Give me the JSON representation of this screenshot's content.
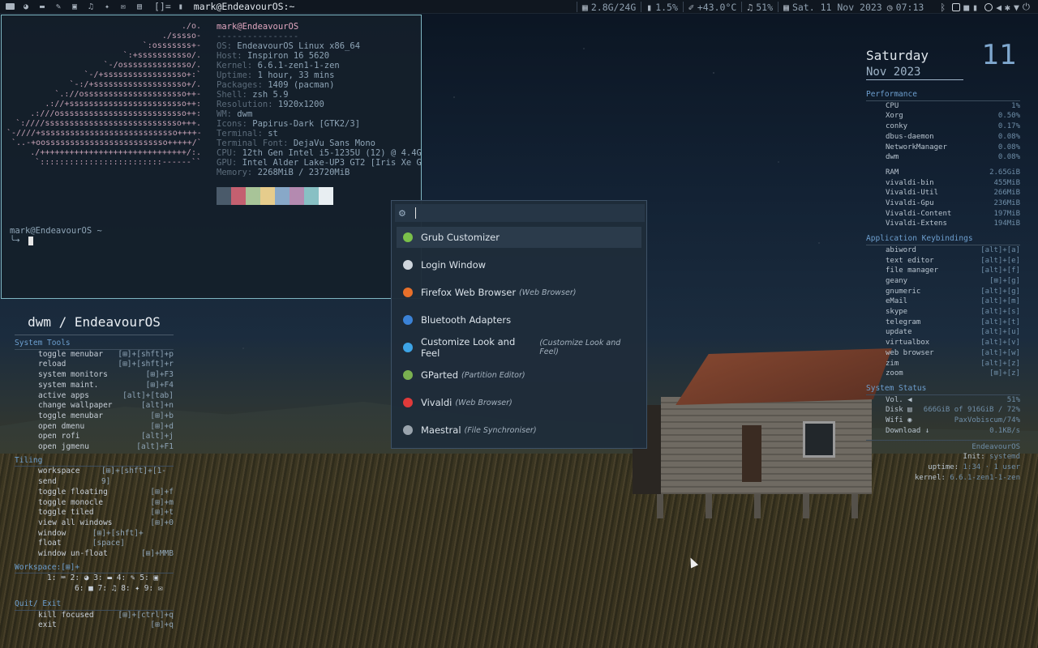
{
  "topbar": {
    "layout": "[]=",
    "window_title": "mark@EndeavourOS:~",
    "stats": {
      "memory": "2.8G/24G",
      "cpu": "1.5%",
      "temp": "+43.0°C",
      "volume": "51%",
      "datetime": "Sat. 11 Nov 2023",
      "time": "07:13"
    },
    "icons": [
      "terminal-icon",
      "globe-icon",
      "folder-icon",
      "editor-icon",
      "image-icon",
      "music-icon",
      "wrench-icon",
      "mail-icon",
      "archive-icon"
    ]
  },
  "terminal": {
    "art": "         ./o.\n       ./sssso-\n     `:osssssss+-\n   `:+sssssssssso/.\n `-/ossssssssssssso/.\n`-/+sssssssssssssssso+:`\n`-:/+sssssssssssssssssso+/.\n `.://osssssssssssssssssssso++-\n.://+ssssssssssssssssssssssso++:\n.:///ossssssssssssssssssssssssso++:\n`:////ssssssssssssssssssssssssssso+++.\n`-////+ssssssssssssssssssssssssssso++++-\n `..-+oosssssssssssssssssssssssso+++++/`\n   ./++++++++++++++++++++++++++++++/:.\n  `:::::::::::::::::::::::::------``",
    "host": "mark@EndeavourOS",
    "separator": "----------------",
    "lines": [
      {
        "k": "OS:",
        "v": "EndeavourOS Linux x86_64"
      },
      {
        "k": "Host:",
        "v": "Inspiron 16 5620"
      },
      {
        "k": "Kernel:",
        "v": "6.6.1-zen1-1-zen"
      },
      {
        "k": "Uptime:",
        "v": "1 hour, 33 mins"
      },
      {
        "k": "Packages:",
        "v": "1409 (pacman)"
      },
      {
        "k": "Shell:",
        "v": "zsh 5.9"
      },
      {
        "k": "Resolution:",
        "v": "1920x1200"
      },
      {
        "k": "WM:",
        "v": "dwm"
      },
      {
        "k": "Icons:",
        "v": "Papirus-Dark [GTK2/3]"
      },
      {
        "k": "Terminal:",
        "v": "st"
      },
      {
        "k": "Terminal Font:",
        "v": "DejaVu Sans Mono"
      },
      {
        "k": "CPU:",
        "v": "12th Gen Intel i5-1235U (12) @ 4.4G"
      },
      {
        "k": "GPU:",
        "v": "Intel Alder Lake-UP3 GT2 [Iris Xe G"
      },
      {
        "k": "Memory:",
        "v": "2268MiB / 23720MiB"
      }
    ],
    "palette": [
      "#4a5a6a",
      "#c46070",
      "#a8c498",
      "#e6cc8c",
      "#88a8c8",
      "#b48ab0",
      "#88c0c4",
      "#e8eef2"
    ],
    "prompt": "mark@EndeavourOS ~"
  },
  "cheat": {
    "title": "dwm / EndeavourOS",
    "sections": [
      {
        "name": "System Tools",
        "rows": [
          [
            "toggle menubar",
            "[⊞]+[shft]+p"
          ],
          [
            "reload",
            "[⊞]+[shft]+r"
          ],
          [
            "system monitors",
            "[⊞]+F3"
          ],
          [
            "system maint.",
            "[⊞]+F4"
          ],
          [
            "active apps",
            "[alt]+[tab]"
          ],
          [
            "change wallpaper",
            "[alt]+n"
          ],
          [
            "toggle menubar",
            "[⊞]+b"
          ],
          [
            "open dmenu",
            "[⊞]+d"
          ],
          [
            "open rofi",
            "[alt]+j"
          ],
          [
            "open jgmenu",
            "[alt]+F1"
          ]
        ]
      },
      {
        "name": "Tiling",
        "rows": [
          [
            "workspace send",
            "[⊞]+[shft]+[1-9]"
          ],
          [
            "toggle floating",
            "[⊞]+f"
          ],
          [
            "toggle monocle",
            "[⊞]+m"
          ],
          [
            "toggle tiled",
            "[⊞]+t"
          ],
          [
            "view all windows",
            "[⊞]+0"
          ],
          [
            "window float",
            "[⊞]+[shft]+[space]"
          ],
          [
            "window un-float",
            "[⊞]+MMB"
          ]
        ]
      }
    ],
    "workspace_label": "Workspace:[⊞]+",
    "workspace_line1": "1: ⌨  2: ◕  3: ▬  4: ✎  5: ▣",
    "workspace_line2": "6: ■  7: ♫  8: ✦  9: ✉",
    "quit": {
      "name": "Quit/ Exit",
      "rows": [
        [
          "kill focused",
          "[⊞]+[ctrl]+q"
        ],
        [
          "exit",
          "[⊞]+q"
        ]
      ]
    }
  },
  "launcher": {
    "items": [
      {
        "label": "Grub Customizer",
        "sub": "",
        "color": "#7ac04a"
      },
      {
        "label": "Login Window",
        "sub": "",
        "color": "#cfd6dd"
      },
      {
        "label": "Firefox Web Browser",
        "sub": "(Web Browser)",
        "color": "#e8702a"
      },
      {
        "label": "Bluetooth Adapters",
        "sub": "",
        "color": "#3b82d6"
      },
      {
        "label": "Customize Look and Feel",
        "sub": "(Customize Look and Feel)",
        "color": "#3da4e6"
      },
      {
        "label": "GParted",
        "sub": "(Partition Editor)",
        "color": "#7ab050"
      },
      {
        "label": "Vivaldi",
        "sub": "(Web Browser)",
        "color": "#e03a3a"
      },
      {
        "label": "Maestral",
        "sub": "(File Synchroniser)",
        "color": "#9aa4ad"
      }
    ]
  },
  "conky": {
    "day": "Saturday",
    "date_num": "11",
    "month": "Nov",
    "year": "2023",
    "performance_title": "Performance",
    "cpu": [
      [
        "CPU",
        "1%"
      ],
      [
        "Xorg",
        "0.50%"
      ],
      [
        "conky",
        "0.17%"
      ],
      [
        "dbus-daemon",
        "0.08%"
      ],
      [
        "NetworkManager",
        "0.08%"
      ],
      [
        "dwm",
        "0.08%"
      ]
    ],
    "ram": [
      [
        "RAM",
        "2.65GiB"
      ],
      [
        "vivaldi-bin",
        "455MiB"
      ],
      [
        "Vivaldi-Util",
        "266MiB"
      ],
      [
        "Vivaldi-Gpu",
        "236MiB"
      ],
      [
        "Vivaldi-Content",
        "197MiB"
      ],
      [
        "Vivaldi-Extens",
        "194MiB"
      ]
    ],
    "keys_title": "Application Keybindings",
    "keys": [
      [
        "abiword",
        "[alt]+[a]"
      ],
      [
        "text editor",
        "[alt]+[e]"
      ],
      [
        "file manager",
        "[alt]+[f]"
      ],
      [
        "geany",
        "[⊞]+[g]"
      ],
      [
        "gnumeric",
        "[alt]+[g]"
      ],
      [
        "eMail",
        "[alt]+[m]"
      ],
      [
        "skype",
        "[alt]+[s]"
      ],
      [
        "telegram",
        "[alt]+[t]"
      ],
      [
        "update",
        "[alt]+[u]"
      ],
      [
        "virtualbox",
        "[alt]+[v]"
      ],
      [
        "web browser",
        "[alt]+[w]"
      ],
      [
        "zim",
        "[alt]+[z]"
      ],
      [
        "zoom",
        "[⊞]+[z]"
      ]
    ],
    "status_title": "System Status",
    "status": [
      [
        "Vol. ◀",
        "51%"
      ],
      [
        "Disk ▤",
        "666GiB of 916GiB / 72%"
      ],
      [
        "Wifi ◉",
        "PaxVobiscum/74%"
      ],
      [
        "Download ↓",
        "0.1KB/s"
      ]
    ],
    "footer": [
      [
        "",
        "EndeavourOS"
      ],
      [
        "Init:",
        "systemd"
      ],
      [
        "uptime:",
        "1:34 · 1 user"
      ],
      [
        "kernel:",
        "6.6.1-zen1-1-zen"
      ]
    ]
  }
}
